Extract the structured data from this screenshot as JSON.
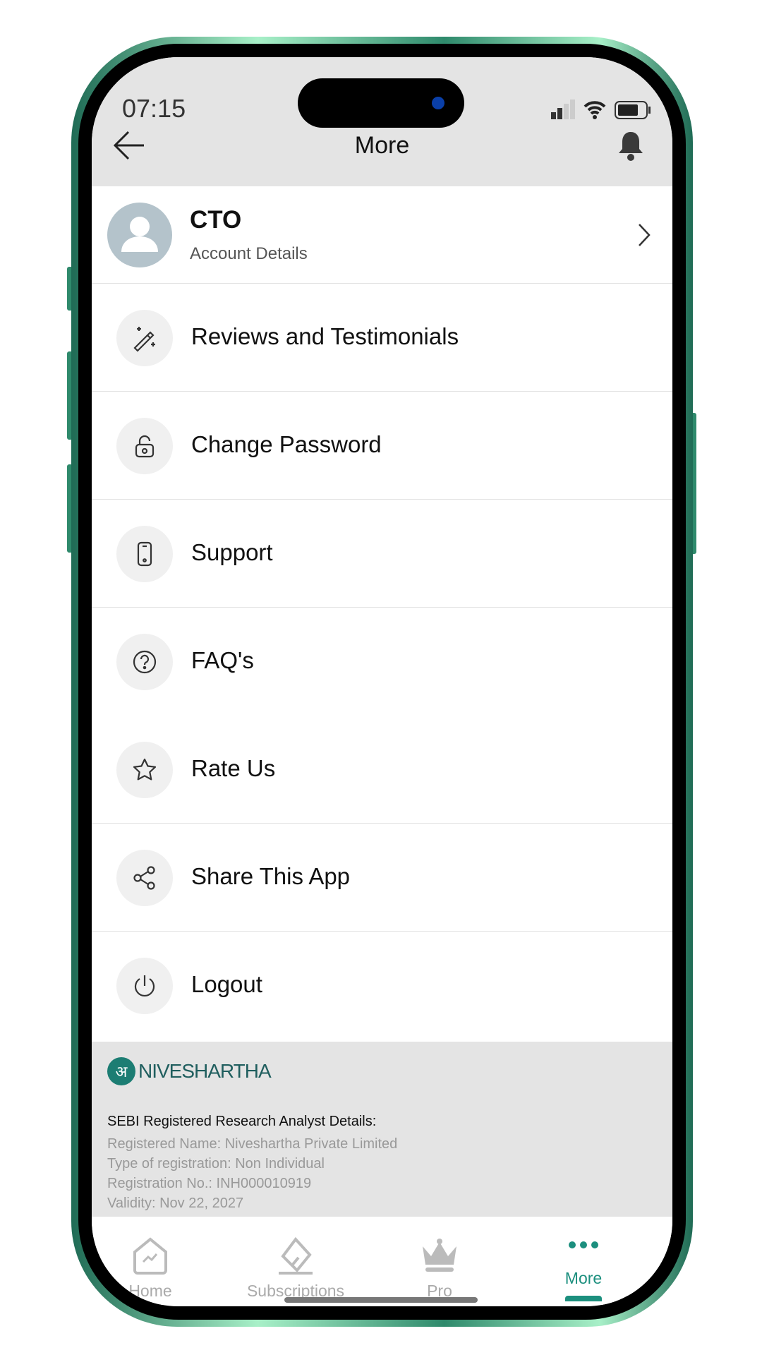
{
  "status_bar": {
    "time": "07:15"
  },
  "header": {
    "title": "More",
    "back_icon": "arrow-left-icon",
    "bell_icon": "bell-icon"
  },
  "profile": {
    "name": "CTO",
    "subtitle": "Account Details"
  },
  "menu": [
    {
      "label": "Reviews and Testimonials",
      "icon": "magic-wand-icon"
    },
    {
      "label": "Change Password",
      "icon": "unlock-icon"
    },
    {
      "label": "Support",
      "icon": "phone-icon"
    },
    {
      "label": "FAQ's",
      "icon": "question-icon"
    },
    {
      "label": "Rate Us",
      "icon": "star-icon"
    },
    {
      "label": "Share This App",
      "icon": "share-icon"
    },
    {
      "label": "Logout",
      "icon": "power-icon"
    }
  ],
  "footer": {
    "logo_text": "NIVESHARTHA",
    "heading": "SEBI Registered Research Analyst Details:",
    "lines": [
      "Registered Name: Niveshartha Private Limited",
      "Type of registration: Non Individual",
      "Registration No.: INH000010919",
      "Validity: Nov 22, 2027"
    ]
  },
  "tabs": [
    {
      "label": "Home"
    },
    {
      "label": "Subscriptions"
    },
    {
      "label": "Pro"
    },
    {
      "label": "More",
      "active": true
    }
  ],
  "colors": {
    "accent": "#1c8f7e",
    "header_bg": "#e4e4e4"
  }
}
